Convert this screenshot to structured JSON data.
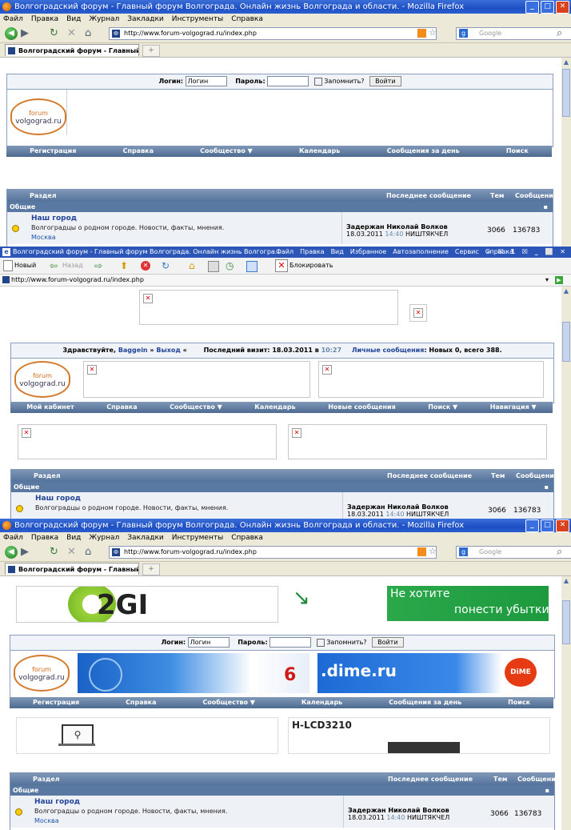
{
  "firefox": {
    "title": "Волгоградский форум - Главный форум Волгограда. Онлайн жизнь Волгограда и области. - Mozilla Firefox",
    "menu": [
      "Файл",
      "Правка",
      "Вид",
      "Журнал",
      "Закладки",
      "Инструменты",
      "Справка"
    ],
    "url": "http://www.forum-volgograd.ru/index.php",
    "search_placeholder": "Google",
    "tab_label": "Волгоградский форум - Главный ф...",
    "newtab": "+"
  },
  "ie": {
    "title": "Волгоградский форум - Главный форум Волгограда. Онлайн жизнь Волгогра...",
    "menu": [
      "Файл",
      "Правка",
      "Вид",
      "Избранное",
      "Автозаполнение",
      "Сервис",
      "Справка"
    ],
    "right_icons": "» ☒ 1 ☒ _ ⬜ ✕",
    "new_label": "Новый",
    "back_label": "Назад",
    "block_label": "Блокировать",
    "url": "http://www.forum-volgograd.ru/index.php"
  },
  "login": {
    "login_label": "Логин:",
    "login_value": "Логин",
    "password_label": "Пароль:",
    "remember_label": "Запомнить?",
    "submit_label": "Войти"
  },
  "logo": {
    "top": "forum",
    "bottom": "volgograd.ru"
  },
  "guest_nav": [
    "Регистрация",
    "Справка",
    "Сообщество ▼",
    "Календарь",
    "Сообщения за день",
    "Поиск"
  ],
  "user": {
    "greeting": "Здравствуйте, ",
    "name": "Baggein",
    "sep": " » ",
    "logout": "Выход",
    "quote": " «",
    "last_visit_label": "Последний визит: 18.03.2011 в ",
    "last_visit_time": "10:27",
    "pm_label": "Личные сообщения",
    "pm_value": ": Новых 0, всего 388."
  },
  "user_nav": [
    "Мой кабинет",
    "Справка",
    "Сообщество ▼",
    "Календарь",
    "Новые сообщения",
    "Поиск ▼",
    "Навигация ▼"
  ],
  "table": {
    "col_section": "Раздел",
    "col_last": "Последнее сообщение",
    "col_threads": "Тем",
    "col_posts": "Сообщений",
    "category": "Общие",
    "collapse": "▪"
  },
  "forum": {
    "title": "Наш город",
    "desc": "Волгоградцы о родном городе. Новости, факты, мнения.",
    "sub": "Москва",
    "last_title": "Задержан Николай Волков",
    "last_date": "18.03.2011",
    "last_time": "14:40",
    "last_user": "НИШТЯКЧЕЛ",
    "threads": "3066",
    "posts": "136783"
  },
  "ads": {
    "banner_logo": "2GI",
    "loss_line1": "Не хотите",
    "loss_line2": "понести убытки?",
    "dime": ".dime.ru",
    "dime_badge": "DiME",
    "six": "6",
    "lcd": "H-LCD3210"
  }
}
